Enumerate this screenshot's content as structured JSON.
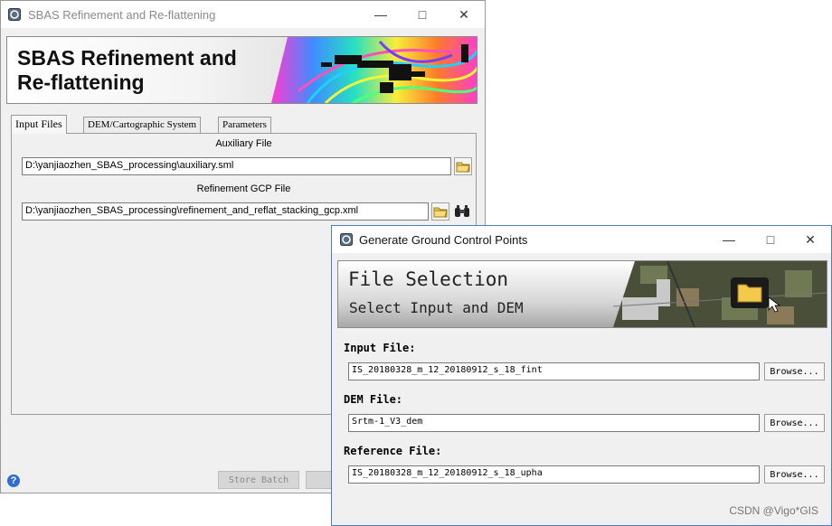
{
  "sbas_window": {
    "title": "SBAS Refinement and Re-flattening",
    "banner_title_line1": "SBAS Refinement and",
    "banner_title_line2": "Re-flattening",
    "tabs": [
      {
        "label": "Input Files",
        "active": true
      },
      {
        "label": "DEM/Cartographic System",
        "active": false
      },
      {
        "label": "Parameters",
        "active": false
      }
    ],
    "auxiliary_label": "Auxiliary File",
    "auxiliary_value": "D:\\yanjiaozhen_SBAS_processing\\auxiliary.sml",
    "gcp_label": "Refinement GCP File",
    "gcp_value": "D:\\yanjiaozhen_SBAS_processing\\refinement_and_reflat_stacking_gcp.xml",
    "store_batch_label": "Store Batch",
    "help_icon": "question-icon"
  },
  "gcp_window": {
    "title": "Generate Ground Control Points",
    "banner_title": "File Selection",
    "banner_subtitle": "Select Input and DEM",
    "input_label": "Input File:",
    "input_value": "IS_20180328_m_12_20180912_s_18_fint",
    "dem_label": "DEM File:",
    "dem_value": "Srtm-1_V3_dem",
    "ref_label": "Reference File:",
    "ref_value": "IS_20180328_m_12_20180912_s_18_upha",
    "browse_label": "Browse..."
  },
  "watermark": "CSDN @Vigo*GIS",
  "colors": {
    "banner_light": "#ffffff",
    "banner_dark": "#a8a8a8",
    "disabled_button": "#d6d6d6"
  }
}
